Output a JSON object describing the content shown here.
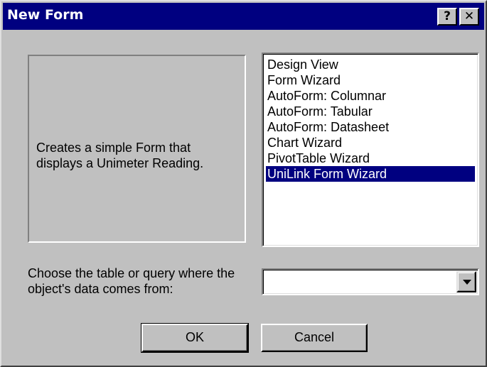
{
  "window": {
    "title": "New Form",
    "help_glyph": "?",
    "close_glyph": "✕"
  },
  "preview": {
    "description": "Creates a simple Form that displays a Unimeter Reading."
  },
  "wizard_list": {
    "items": [
      "Design View",
      "Form Wizard",
      "AutoForm:  Columnar",
      "AutoForm:  Tabular",
      "AutoForm:  Datasheet",
      "Chart Wizard",
      "PivotTable Wizard",
      "UniLink Form Wizard"
    ],
    "selected_index": 7
  },
  "source": {
    "label": "Choose the table or query where the object's data comes from:",
    "value": ""
  },
  "buttons": {
    "ok": "OK",
    "cancel": "Cancel"
  },
  "colors": {
    "titlebar": "#000080",
    "face": "#c0c0c0",
    "selection": "#000080"
  }
}
